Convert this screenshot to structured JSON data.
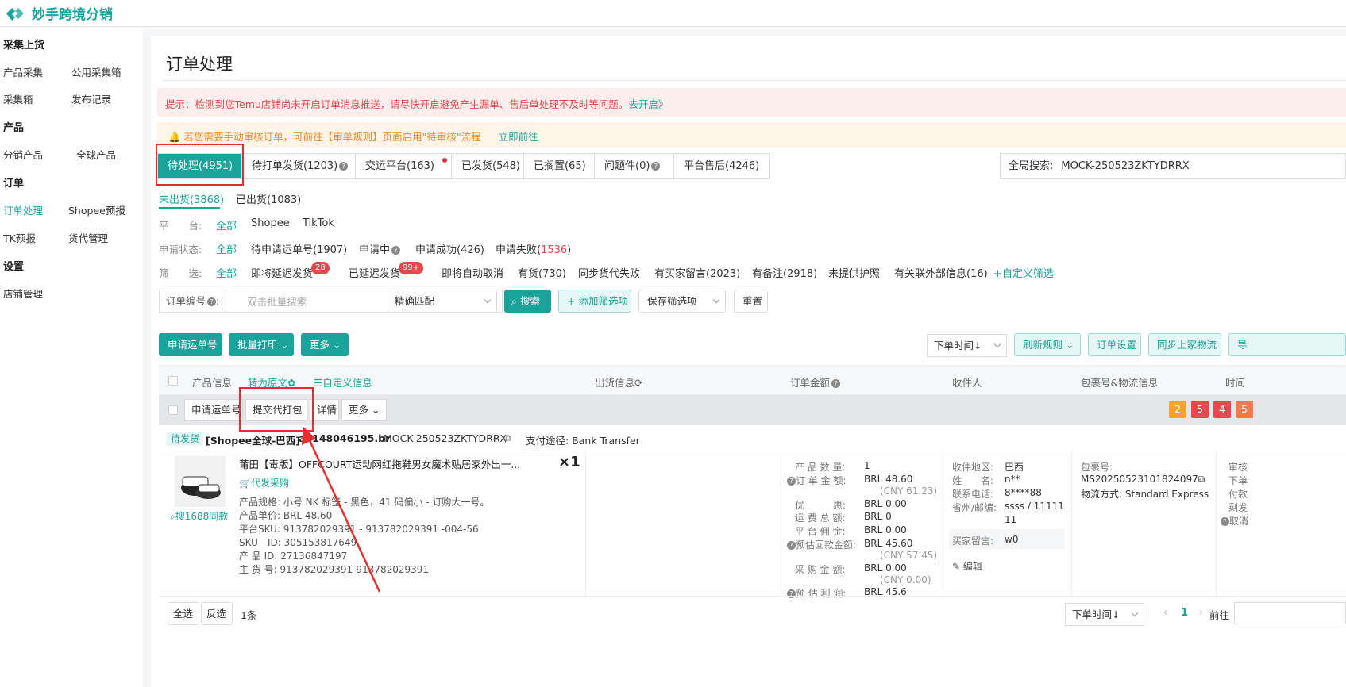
{
  "app": {
    "name": "妙手跨境分销",
    "accent": "#1aa39a"
  },
  "sidebar": {
    "sections": [
      {
        "title": "采集上货",
        "items": [
          "产品采集",
          "公用采集箱",
          "采集箱",
          "发布记录"
        ]
      },
      {
        "title": "产品",
        "items": [
          "分销产品",
          "全球产品"
        ]
      },
      {
        "title": "订单",
        "items": [
          "订单处理",
          "Shopee预报",
          "TK预报",
          "货代管理"
        ]
      },
      {
        "title": "设置",
        "items": [
          "店铺管理"
        ]
      }
    ],
    "active": "订单处理"
  },
  "page": {
    "title": "订单处理"
  },
  "notices": {
    "red_text": "提示：检测到您Temu店铺尚未开启订单消息推送，请尽快开启避免产生漏单、售后单处理不及时等问题。",
    "red_link": "去开启》",
    "orange_text": "若您需要手动审核订单，可前往【审单规则】页面启用\"待审核\"流程",
    "orange_link": "立即前往"
  },
  "tabs": [
    "待处理(4951)",
    "待打单发货(1203)",
    "交运平台(163)",
    "已发货(548)",
    "已搁置(65)",
    "问题件(0)",
    "平台售后(4246)"
  ],
  "global_search": {
    "label": "全局搜索:",
    "value": "MOCK-250523ZKTYDRRX"
  },
  "subtabs": [
    "未出货(3868)",
    "已出货(1083)"
  ],
  "filters": {
    "platform": {
      "label": "平　　台:",
      "options": [
        "全部",
        "Shopee",
        "TikTok"
      ]
    },
    "apply_status": {
      "label": "申请状态:",
      "options": [
        "全部",
        "待申请运单号(1907)",
        "申请中",
        "申请成功(426)",
        "申请失败("
      ],
      "fail_count": "1536",
      "fail_close": ")"
    },
    "screen": {
      "label": "筛　　选:",
      "options": [
        "全部",
        "即将延迟发货",
        "已延迟发货",
        "即将自动取消",
        "有货(730)",
        "同步货代失败",
        "有买家留言(2023)",
        "有备注(2918)",
        "未提供护照",
        "有关联外部信息(16)"
      ],
      "badge_soon_delay": "28",
      "badge_delayed": "99+",
      "custom": "+自定义筛选"
    }
  },
  "search_bar": {
    "field_label": "订单编号",
    "placeholder": "双击批量搜索",
    "match": "精确匹配",
    "search_btn": "搜索",
    "add_filter_btn": "+ 添加筛选项",
    "save_filter_btn": "保存筛选项",
    "reset_btn": "重置"
  },
  "toolbar": {
    "apply_waybill": "申请运单号",
    "batch_print": "批量打印",
    "more": "更多",
    "sort": "下单时间↓",
    "refresh_rule": "刷新规则",
    "order_settings": "订单设置",
    "sync_logistics": "同步上家物流",
    "export": "导"
  },
  "table_header": {
    "product_info": "产品信息",
    "to_original": "转为原文",
    "custom_info": "自定义信息",
    "shipping_info": "出货信息",
    "order_amount": "订单金额",
    "recipient": "收件人",
    "package_logistics": "包裹号&物流信息",
    "time": "时间"
  },
  "row_actions": [
    "申请运单号",
    "提交代打包",
    "详情",
    "更多"
  ],
  "stat_squares": [
    {
      "value": "2",
      "color": "#f7a229"
    },
    {
      "value": "5",
      "color": "#e5484d"
    },
    {
      "value": "4",
      "color": "#e5484d"
    },
    {
      "value": "5",
      "color": "#f07a50"
    }
  ],
  "order": {
    "status": "待发货",
    "shop": "[Shopee全球-巴西]",
    "account": "a1148046195.br",
    "order_no": "MOCK-250523ZKTYDRRX",
    "payment": "支付途径: Bank Transfer",
    "product": {
      "title": "莆田【毒版】OFFCOURT运动网红拖鞋男女魔术贴居家外出一...",
      "qty": "×1",
      "purchase_link": "代发采购",
      "search_1688": "搜1688同款",
      "lines": [
        "产品规格: 小号 NK 标签 - 黑色，41 码偏小 - 订购大一号。",
        "产品单价: BRL 48.60",
        "平台SKU: 913782029391 - 913782029391 -004-56",
        "SKU　ID: 305153817649",
        "产 品 ID: 27136847197",
        "主 货 号: 913782029391-913782029391"
      ]
    },
    "finance": [
      {
        "label": "产 品 数 量:",
        "value": "1",
        "sub": ""
      },
      {
        "label": "订 单 金 额:",
        "value": "BRL 48.60",
        "sub": "(CNY 61.23)"
      },
      {
        "label": "优　　　惠:",
        "value": "BRL 0.00",
        "sub": ""
      },
      {
        "label": "运 费 总 额:",
        "value": "BRL 0",
        "sub": ""
      },
      {
        "label": "平 台 佣 金:",
        "value": "BRL 0.00",
        "sub": ""
      },
      {
        "label": "预估回款金额:",
        "value": "BRL 45.60",
        "sub": "(CNY 57.45)"
      },
      {
        "label": "采 购 金 额:",
        "value": "BRL 0.00",
        "sub": "(CNY 0.00)"
      },
      {
        "label": "预 估 利 润:",
        "value": "BRL 45.6",
        "sub": ""
      }
    ],
    "recipient": {
      "region_label": "收件地区:",
      "region": "巴西",
      "name_label": "姓　　名:",
      "name": "n**",
      "phone_label": "联系电话:",
      "phone": "8****88",
      "zip_label": "省州/邮编:",
      "zip": "ssss / 11111",
      "zip2": "11",
      "msg_label": "买家留言:",
      "msg": "w0",
      "edit": "编辑"
    },
    "package": {
      "no_label": "包裹号:",
      "no": "MS20250523101824097",
      "method": "物流方式: Standard Express"
    },
    "time_col": [
      "审核",
      "下单",
      "付款",
      "剩发",
      "取消"
    ]
  },
  "footer": {
    "select_all": "全选",
    "invert": "反选",
    "count": "1条",
    "sort": "下单时间↓",
    "page": "1",
    "goto": "前往"
  }
}
